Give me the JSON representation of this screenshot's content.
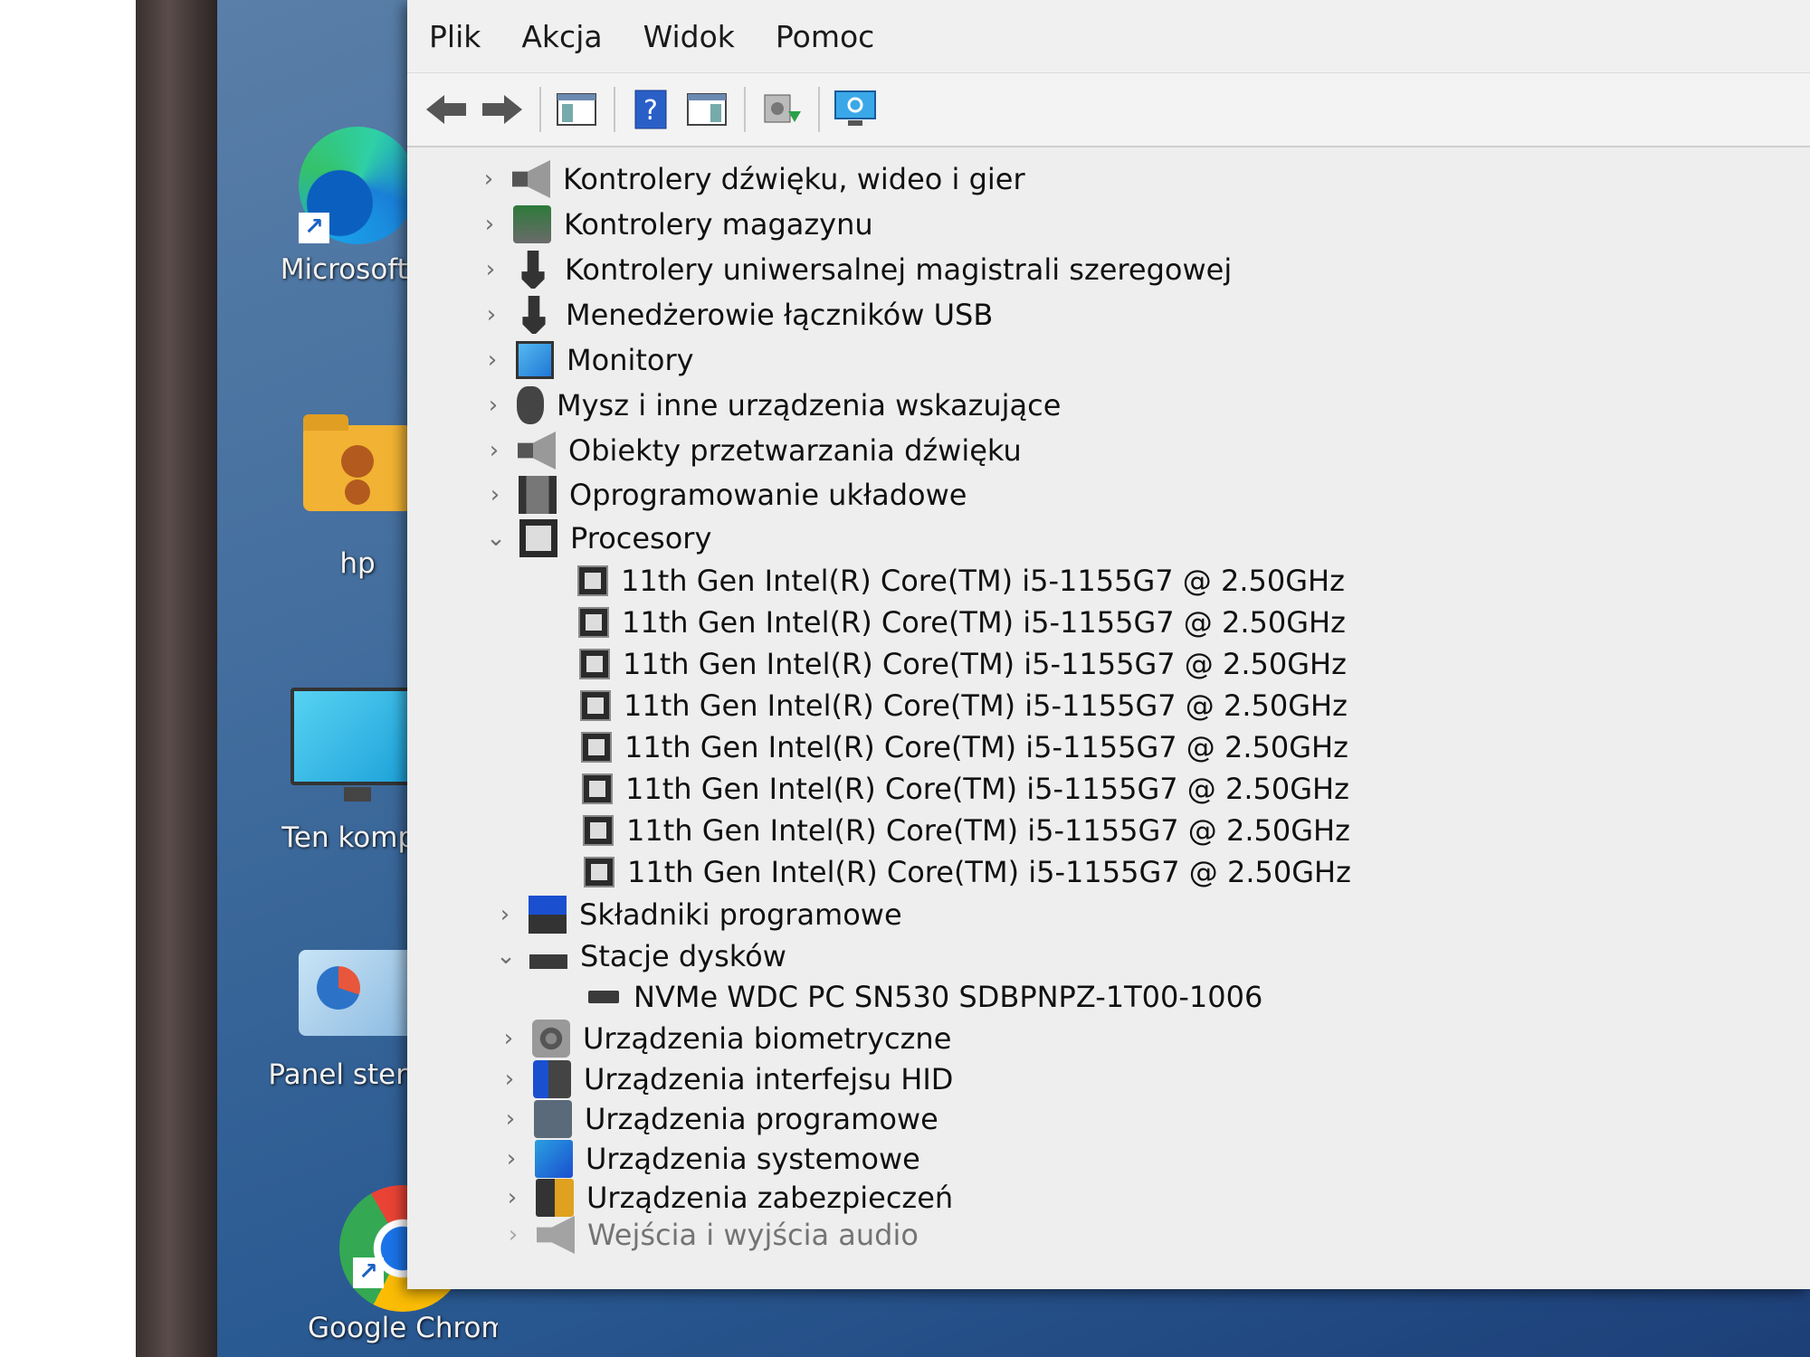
{
  "desktop": {
    "icons": [
      {
        "label": "Microsoft E",
        "icon": "edge-icon"
      },
      {
        "label": "hp",
        "icon": "user-folder-icon"
      },
      {
        "label": "Ten kompu",
        "icon": "monitor-icon"
      },
      {
        "label": "Panel sterow",
        "icon": "control-panel-icon"
      },
      {
        "label": "Google Chrome",
        "icon": "chrome-icon"
      }
    ]
  },
  "menubar": {
    "items": [
      "Plik",
      "Akcja",
      "Widok",
      "Pomoc"
    ]
  },
  "toolbar": {
    "buttons": [
      "back-icon",
      "forward-icon",
      "show-hide-console-tree-icon",
      "help-icon",
      "show-hide-action-pane-icon",
      "update-driver-icon",
      "scan-hardware-icon"
    ]
  },
  "tree": {
    "categories": [
      {
        "label": "Kontrolery dźwięku, wideo i gier",
        "expanded": false,
        "icon": "speaker-icon"
      },
      {
        "label": "Kontrolery magazynu",
        "expanded": false,
        "icon": "storage-controller-icon"
      },
      {
        "label": "Kontrolery uniwersalnej magistrali szeregowej",
        "expanded": false,
        "icon": "usb-icon"
      },
      {
        "label": "Menedżerowie łączników USB",
        "expanded": false,
        "icon": "usb-connector-icon"
      },
      {
        "label": "Monitory",
        "expanded": false,
        "icon": "monitor-icon"
      },
      {
        "label": "Mysz i inne urządzenia wskazujące",
        "expanded": false,
        "icon": "mouse-icon"
      },
      {
        "label": "Obiekty przetwarzania dźwięku",
        "expanded": false,
        "icon": "audio-processing-icon"
      },
      {
        "label": "Oprogramowanie układowe",
        "expanded": false,
        "icon": "firmware-icon"
      },
      {
        "label": "Procesory",
        "expanded": true,
        "icon": "processor-icon"
      }
    ],
    "processors": [
      "11th Gen Intel(R) Core(TM) i5-1155G7 @ 2.50GHz",
      "11th Gen Intel(R) Core(TM) i5-1155G7 @ 2.50GHz",
      "11th Gen Intel(R) Core(TM) i5-1155G7 @ 2.50GHz",
      "11th Gen Intel(R) Core(TM) i5-1155G7 @ 2.50GHz",
      "11th Gen Intel(R) Core(TM) i5-1155G7 @ 2.50GHz",
      "11th Gen Intel(R) Core(TM) i5-1155G7 @ 2.50GHz",
      "11th Gen Intel(R) Core(TM) i5-1155G7 @ 2.50GHz",
      "11th Gen Intel(R) Core(TM) i5-1155G7 @ 2.50GHz"
    ],
    "software_components": "Składniki programowe",
    "disk_drives": {
      "label": "Stacje dysków",
      "expanded": true,
      "children": [
        "NVMe WDC PC SN530 SDBPNPZ-1T00-1006"
      ]
    },
    "more_categories": [
      "Urządzenia biometryczne",
      "Urządzenia interfejsu HID",
      "Urządzenia programowe",
      "Urządzenia systemowe",
      "Urządzenia zabezpieczeń",
      "Wejścia i wyjścia audio"
    ]
  },
  "glyphs": {
    "collapsed": "›",
    "expanded": "⌄"
  }
}
